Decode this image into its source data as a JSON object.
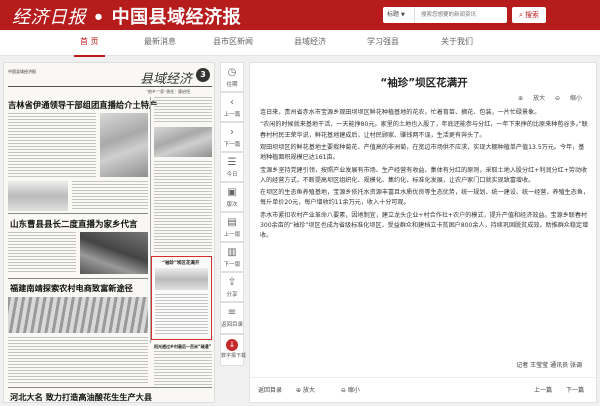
{
  "header": {
    "logo_script": "经济日报",
    "logo_sep": "•",
    "logo_main": "中国县域经济报",
    "search_field": "标题",
    "search_placeholder": "搜索您想要的新闻资讯",
    "search_button": "搜索",
    "brand_color": "#b71c1c"
  },
  "nav": {
    "items": [
      {
        "label": "首  页",
        "active": true
      },
      {
        "label": "最新消息"
      },
      {
        "label": "县市区新闻"
      },
      {
        "label": "县域经济"
      },
      {
        "label": "学习强县"
      },
      {
        "label": "关于我们"
      }
    ]
  },
  "paper": {
    "masthead_left": "中国县域经济报",
    "masthead_right": "县域经济",
    "page_number": "3",
    "sub_line": "“他乡”“家”责任：廖启恒",
    "headlines": [
      "吉林省伊通领导干部组团直播给介土特产",
      "山东曹县县长二度直播为家乡代言",
      "福建南靖探索农村电商致富新途径",
      "河北大名   致力打造高油酸花生生产大县"
    ],
    "small_titles": [
      "“袖珍”坝区花满开",
      "阳光透过乡村最后一百米“疏通”"
    ]
  },
  "toolbar": {
    "items": [
      {
        "icon": "◷",
        "label": "往期"
      },
      {
        "icon": "‹",
        "label": "上一篇"
      },
      {
        "icon": "›",
        "label": "下一篇"
      },
      {
        "icon": "☰",
        "label": "今日"
      },
      {
        "icon": "▣",
        "label": "版次"
      },
      {
        "icon": "▤",
        "label": "上一版"
      },
      {
        "icon": "▥",
        "label": "下一版"
      },
      {
        "icon": "⇪",
        "label": "分享"
      },
      {
        "icon": "≡",
        "label": "返回目录"
      },
      {
        "icon": "↓",
        "label": "数字报下载"
      }
    ]
  },
  "article": {
    "title": "“袖珍”坝区花满开",
    "zoom_in": "放大",
    "zoom_out": "缩小",
    "paragraphs": [
      "连日来，贵州省赤水市宝源乡观田坝坝区鲜花种植基地的花农，忙着育苗、摘花、包装，一片忙碌景象。",
      "“农闲的时候就来基地干活，一天能挣80元。家里的土地也入股了，年底还能参与分红，一年下来挣的比原来种苞谷多。”联春村村民王荣华说，鲜花基地建成后，让村民顾家、赚钱两不误，生活更有奔头了。",
      "观田坝坝区的鲜花基地主要栽种菊花、产值高的非洲菊，在宽边市场供不应求，实现大棚种植单产值13.5万元。今年，基地种植面积规模已达161亩。",
      "宝源乡坚持党建引领，按照产业发展有市场、生产经营有收益、集体有分红的原则，采取土地入股分红+利润分红+劳动收入的经营方式，不断提高坝区组织化、规模化、集约化、标准化发展，让农户家门口就实现致富增收。",
      "在坝区的生态鱼养殖基地，宝源乡依托水资源丰富且水质优良等生态优势，统一规划、统一建设、统一经营，养殖生态鱼，每斤单价20元，每户增收约11余万元，收入十分可观。",
      "赤水市紧扣农村产业革命八要素，因地制宜，建立龙头企业+村合作社+农户的模式，提升产值和经济效益。宝源乡联春村300余亩的“袖珍”坝区也成为省级标准化坝区，受益群众和建档立卡贫困户800余人，持续巩固脱贫成效，助推群众稳定增收。"
    ],
    "author": "记者 王莹莹 通讯员 张调",
    "footer": {
      "back_toc": "返回目录",
      "zoom_in": "放大",
      "zoom_out": "缩小",
      "prev": "上一篇",
      "next": "下一篇"
    }
  }
}
